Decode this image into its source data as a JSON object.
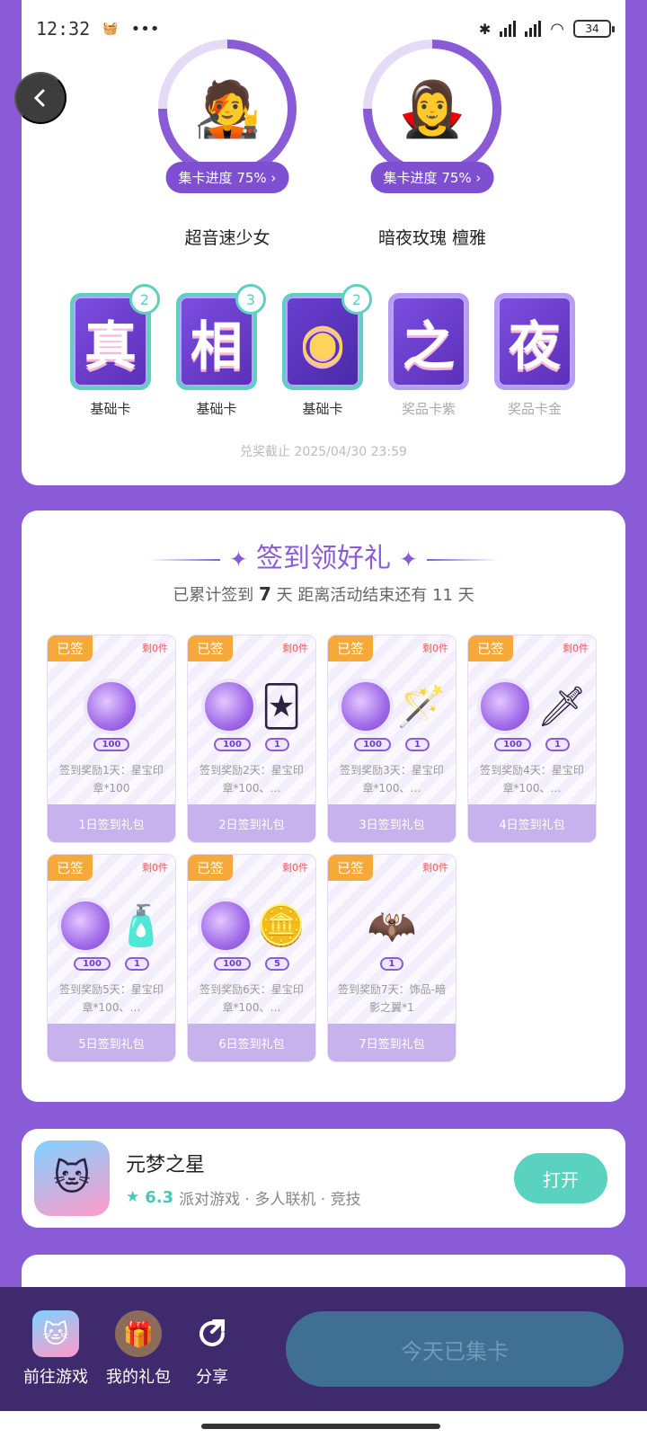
{
  "status": {
    "time": "12:32",
    "battery": "34",
    "more": "•••"
  },
  "characters": [
    {
      "name": "超音速少女",
      "progress_label": "集卡进度 75%",
      "progress": 0.75,
      "avatar": "🧑‍🎤"
    },
    {
      "name": "暗夜玫瑰 檀雅",
      "progress_label": "集卡进度 75%",
      "progress": 0.75,
      "avatar": "🧛‍♀️"
    }
  ],
  "collect_cards": [
    {
      "char": "真",
      "label": "基础卡",
      "count": "2",
      "locked": false
    },
    {
      "char": "相",
      "label": "基础卡",
      "count": "3",
      "locked": false
    },
    {
      "char": "◉",
      "label": "基础卡",
      "count": "2",
      "locked": false
    },
    {
      "char": "之",
      "label": "奖品卡紫",
      "count": "",
      "locked": true
    },
    {
      "char": "夜",
      "label": "奖品卡金",
      "count": "",
      "locked": true
    }
  ],
  "deadline": "兑奖截止 2025/04/30 23:59",
  "sign": {
    "title": "签到领好礼",
    "summary_prefix": "已累计签到",
    "days_signed": "7",
    "summary_middle": "天  距离活动结束还有",
    "days_left": "11",
    "summary_suffix": "天",
    "signed_tag": "已签",
    "remain_text": "剩0件",
    "days": [
      {
        "desc": "签到奖励1天：星宝印章*100",
        "button": "1日签到礼包",
        "qty": [
          "100"
        ],
        "extra": ""
      },
      {
        "desc": "签到奖励2天：星宝印章*100、…",
        "button": "2日签到礼包",
        "qty": [
          "100",
          "1"
        ],
        "extra": "🃏"
      },
      {
        "desc": "签到奖励3天：星宝印章*100、…",
        "button": "3日签到礼包",
        "qty": [
          "100",
          "1"
        ],
        "extra": "🪄"
      },
      {
        "desc": "签到奖励4天：星宝印章*100、…",
        "button": "4日签到礼包",
        "qty": [
          "100",
          "1"
        ],
        "extra": "🗡"
      },
      {
        "desc": "签到奖励5天：星宝印章*100、…",
        "button": "5日签到礼包",
        "qty": [
          "100",
          "1"
        ],
        "extra": "🧴"
      },
      {
        "desc": "签到奖励6天：星宝印章*100、…",
        "button": "6日签到礼包",
        "qty": [
          "100",
          "5"
        ],
        "extra": "🪙"
      },
      {
        "desc": "签到奖励7天：饰品-暗影之翼*1",
        "button": "7日签到礼包",
        "qty": [
          "1"
        ],
        "extra": "🦇"
      }
    ]
  },
  "app": {
    "name": "元梦之星",
    "rating": "6.3",
    "tags": "派对游戏 · 多人联机 · 竞技",
    "open_label": "打开"
  },
  "bottom": {
    "goto_game": "前往游戏",
    "my_gifts": "我的礼包",
    "share": "分享",
    "primary": "今天已集卡"
  }
}
